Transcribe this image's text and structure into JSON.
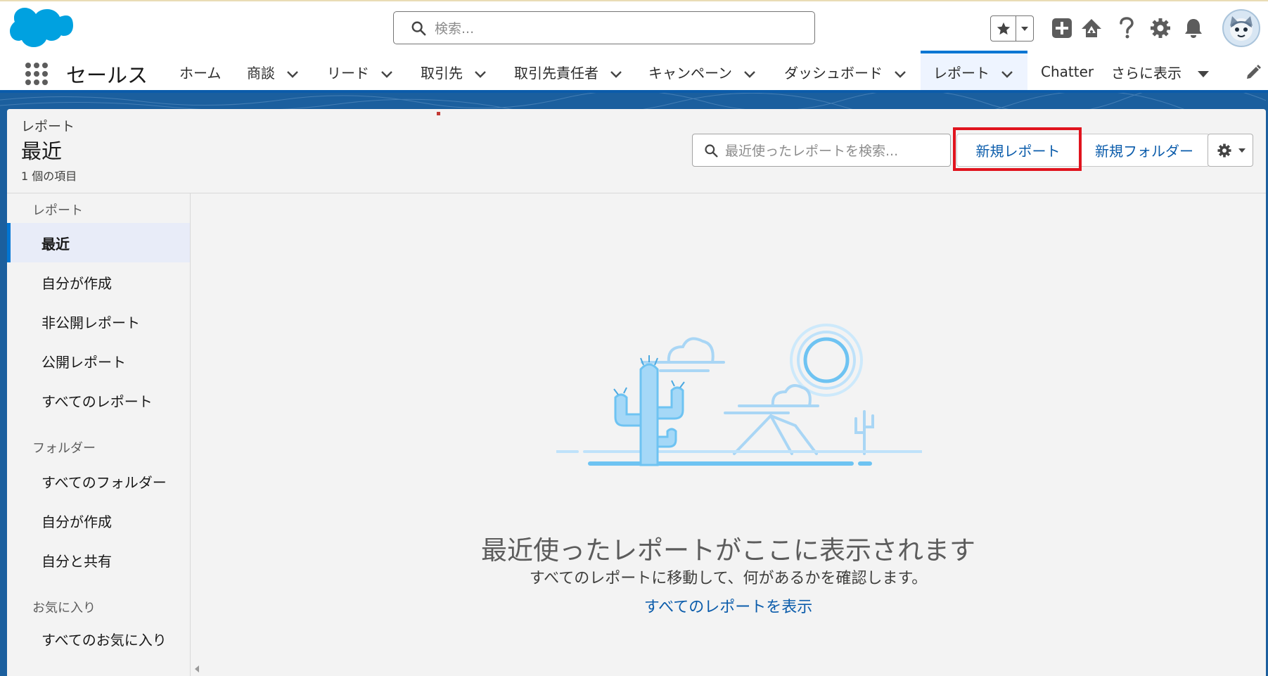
{
  "header": {
    "search_placeholder": "検索...",
    "icons": [
      "favorites-star-icon",
      "favorites-dropdown-icon",
      "global-actions-plus-icon",
      "trailhead-icon",
      "help-icon",
      "setup-gear-icon",
      "notifications-bell-icon",
      "user-avatar"
    ]
  },
  "nav": {
    "app_name": "セールス",
    "items": [
      {
        "label": "ホーム",
        "dropdown": false
      },
      {
        "label": "商談",
        "dropdown": true
      },
      {
        "label": "リード",
        "dropdown": true
      },
      {
        "label": "取引先",
        "dropdown": true
      },
      {
        "label": "取引先責任者",
        "dropdown": true
      },
      {
        "label": "キャンペーン",
        "dropdown": true
      },
      {
        "label": "ダッシュボード",
        "dropdown": true
      },
      {
        "label": "レポート",
        "dropdown": true,
        "active": true
      },
      {
        "label": "Chatter",
        "dropdown": false
      },
      {
        "label": "さらに表示",
        "dropdown": true
      }
    ]
  },
  "list_header": {
    "object_label": "レポート",
    "title": "最近",
    "item_count": "1 個の項目",
    "search_placeholder": "最近使ったレポートを検索...",
    "new_report": "新規レポート",
    "new_folder": "新規フォルダー"
  },
  "sidebar": {
    "reports_heading": "レポート",
    "reports": [
      "最近",
      "自分が作成",
      "非公開レポート",
      "公開レポート",
      "すべてのレポート"
    ],
    "folders_heading": "フォルダー",
    "folders": [
      "すべてのフォルダー",
      "自分が作成",
      "自分と共有"
    ],
    "favorites_heading": "お気に入り",
    "favorites": [
      "すべてのお気に入り"
    ]
  },
  "empty_state": {
    "title": "最近使ったレポートがここに表示されます",
    "subtitle": "すべてのレポートに移動して、何があるかを確認します。",
    "link": "すべてのレポートを表示"
  },
  "colors": {
    "brand_blue": "#0176d3",
    "link_blue": "#0b5cab",
    "banner_blue": "#1b5f9e",
    "highlight_red": "#e0141e"
  }
}
